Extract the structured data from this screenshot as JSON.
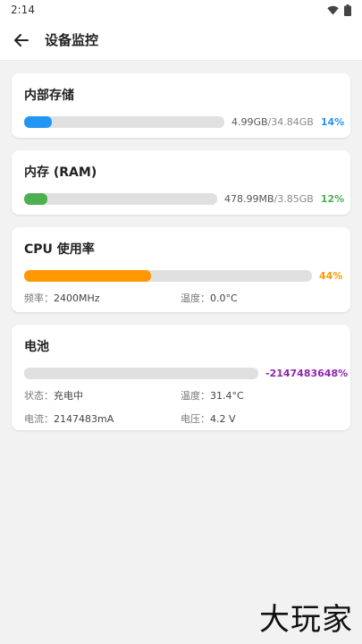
{
  "status_bar": {
    "time": "2:14"
  },
  "app_bar": {
    "title": "设备监控"
  },
  "storage": {
    "title": "内部存储",
    "used": "4.99GB",
    "separator": "/",
    "total": "34.84GB",
    "percent": "14%",
    "fill_fraction": 0.14,
    "color": "#2196f3"
  },
  "memory": {
    "title": "内存 (RAM)",
    "used": "478.99MB",
    "separator": "/",
    "total": "3.85GB",
    "percent": "12%",
    "fill_fraction": 0.12,
    "color": "#4caf50"
  },
  "cpu": {
    "title": "CPU 使用率",
    "percent": "44%",
    "fill_fraction": 0.44,
    "color": "#ff9800",
    "freq_label": "频率：",
    "freq_value": "2400MHz",
    "temp_label": "温度：",
    "temp_value": "0.0°C"
  },
  "battery": {
    "title": "电池",
    "percent": "-2147483648%",
    "fill_fraction": 0,
    "color": "#8e24aa",
    "status_label": "状态：",
    "status_value": "充电中",
    "temp_label": "温度：",
    "temp_value": "31.4°C",
    "current_label": "电流：",
    "current_value": "2147483mA",
    "voltage_label": "电压：",
    "voltage_value": "4.2 V"
  },
  "watermark": "大玩家"
}
